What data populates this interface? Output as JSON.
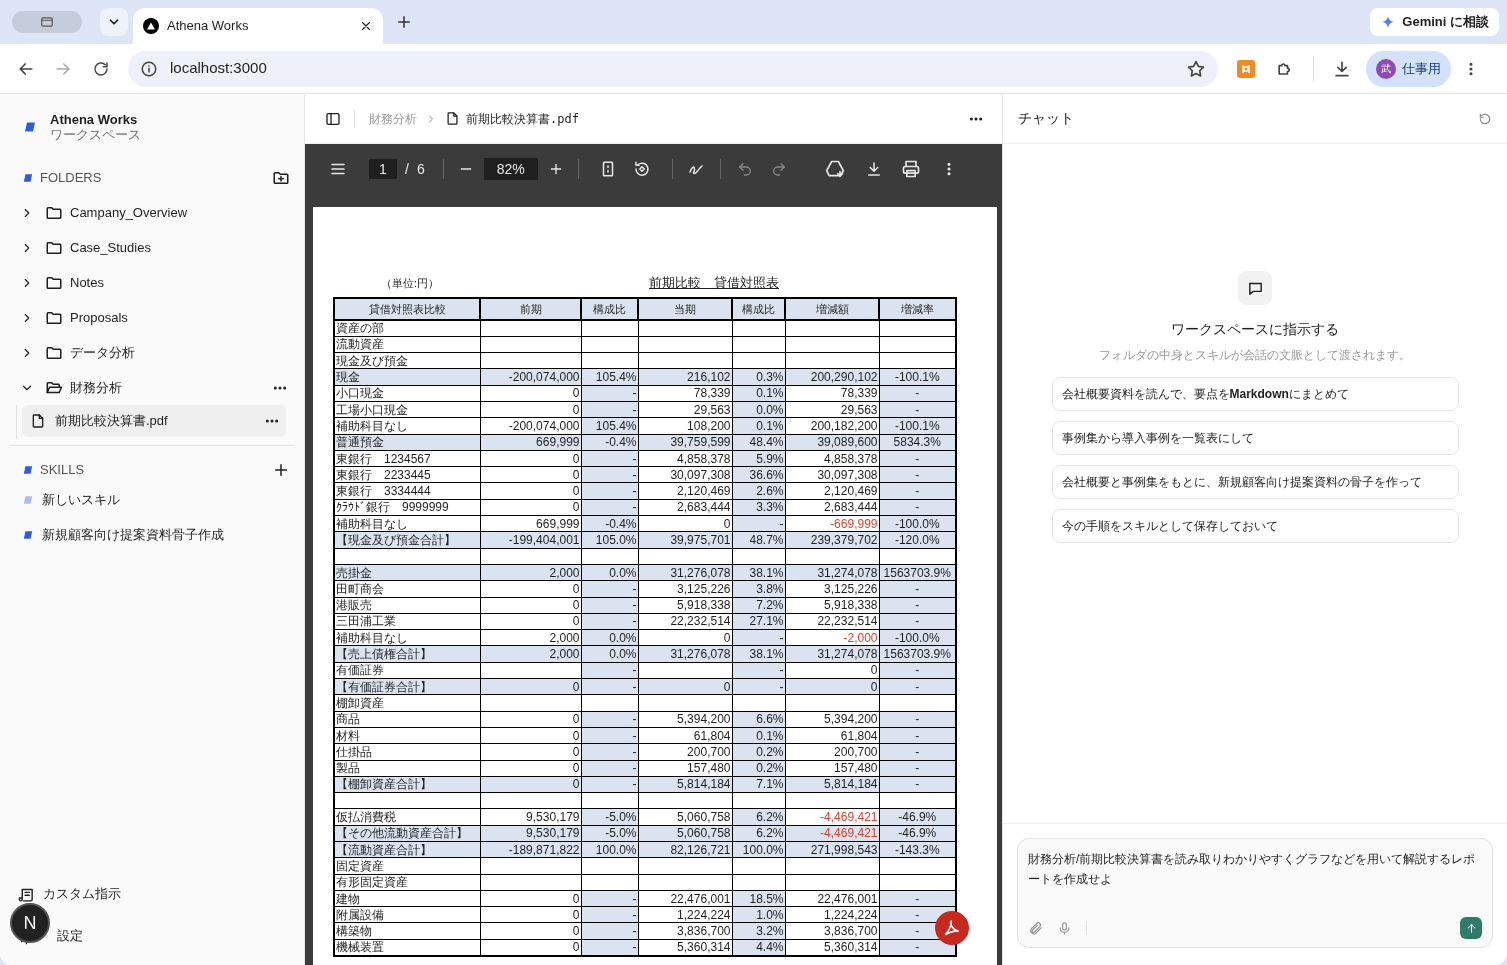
{
  "browser": {
    "tab_title": "Athena Works",
    "url": "localhost:3000",
    "gemini_button": "Gemini に相談",
    "profile_avatar": "武",
    "profile_name": "仕事用"
  },
  "sidebar": {
    "workspace_name": "Athena Works",
    "workspace_subtitle": "ワークスペース",
    "folders_heading": "FOLDERS",
    "folders": [
      {
        "label": "Campany_Overview",
        "expanded": false,
        "selected": false
      },
      {
        "label": "Case_Studies",
        "expanded": false,
        "selected": false
      },
      {
        "label": "Notes",
        "expanded": false,
        "selected": false
      },
      {
        "label": "Proposals",
        "expanded": false,
        "selected": false
      },
      {
        "label": "データ分析",
        "expanded": false,
        "selected": false
      },
      {
        "label": "財務分析",
        "expanded": true,
        "selected": false,
        "children": [
          {
            "label": "前期比較決算書.pdf",
            "selected": true
          }
        ]
      }
    ],
    "skills_heading": "SKILLS",
    "skills": [
      {
        "label": "新しいスキル",
        "color": "#a9bcf5"
      },
      {
        "label": "新規顧客向け提案資料骨子作成",
        "color": "#2d5be3"
      }
    ],
    "custom_instructions": "カスタム指示",
    "settings": "設定",
    "floating_button": "N"
  },
  "document": {
    "breadcrumb": [
      "財務分析",
      "前期比較決算書.pdf"
    ],
    "pdf_toolbar": {
      "page": "1",
      "page_separator": "/",
      "page_count": "6",
      "zoom": "82%"
    },
    "unit_label": "（単位:円）",
    "title": "前期比較　貸借対照表",
    "table": {
      "columns": [
        "貸借対照表比較",
        "前期",
        "構成比",
        "当期",
        "構成比",
        "増減額",
        "増減率"
      ],
      "rows": [
        {
          "kind": "heading",
          "label": "資産の部"
        },
        {
          "kind": "heading",
          "label": "流動資産"
        },
        {
          "kind": "heading",
          "label": "現金及び預金"
        },
        {
          "kind": "total",
          "label": "現金",
          "cells": [
            "-200,074,000",
            "105.4%",
            "216,102",
            "0.3%",
            "200,290,102",
            "-100.1%"
          ],
          "alert": false
        },
        {
          "kind": "detail",
          "label": "小口現金",
          "cells": [
            "0",
            "-",
            "78,339",
            "0.1%",
            "78,339",
            "-"
          ],
          "alert": false
        },
        {
          "kind": "detail",
          "label": "工場小口現金",
          "cells": [
            "0",
            "-",
            "29,563",
            "0.0%",
            "29,563",
            "-"
          ],
          "alert": false
        },
        {
          "kind": "detail",
          "label": "補助科目なし",
          "cells": [
            "-200,074,000",
            "105.4%",
            "108,200",
            "0.1%",
            "200,182,200",
            "-100.1%"
          ],
          "alert": false
        },
        {
          "kind": "total",
          "label": "普通預金",
          "cells": [
            "669,999",
            "-0.4%",
            "39,759,599",
            "48.4%",
            "39,089,600",
            "5834.3%"
          ],
          "alert": false
        },
        {
          "kind": "detail",
          "label": "東銀行　1234567",
          "cells": [
            "0",
            "-",
            "4,858,378",
            "5.9%",
            "4,858,378",
            "-"
          ],
          "alert": false
        },
        {
          "kind": "detail",
          "label": "東銀行　2233445",
          "cells": [
            "0",
            "-",
            "30,097,308",
            "36.6%",
            "30,097,308",
            "-"
          ],
          "alert": false
        },
        {
          "kind": "detail",
          "label": "東銀行　3334444",
          "cells": [
            "0",
            "-",
            "2,120,469",
            "2.6%",
            "2,120,469",
            "-"
          ],
          "alert": false
        },
        {
          "kind": "detail",
          "label": "ｸﾗｳﾄﾞ銀行　9999999",
          "cells": [
            "0",
            "-",
            "2,683,444",
            "3.3%",
            "2,683,444",
            "-"
          ],
          "alert": false
        },
        {
          "kind": "detail",
          "label": "補助科目なし",
          "cells": [
            "669,999",
            "-0.4%",
            "0",
            "-",
            "-669,999",
            "-100.0%"
          ],
          "alert": true
        },
        {
          "kind": "total",
          "label": "【現金及び預金合計】",
          "cells": [
            "-199,404,001",
            "105.0%",
            "39,975,701",
            "48.7%",
            "239,379,702",
            "-120.0%"
          ],
          "alert": false
        },
        {
          "kind": "blank"
        },
        {
          "kind": "total",
          "label": "売掛金",
          "cells": [
            "2,000",
            "0.0%",
            "31,276,078",
            "38.1%",
            "31,274,078",
            "1563703.9%"
          ],
          "alert": false
        },
        {
          "kind": "detail",
          "label": "田町商会",
          "cells": [
            "0",
            "-",
            "3,125,226",
            "3.8%",
            "3,125,226",
            "-"
          ],
          "alert": false
        },
        {
          "kind": "detail",
          "label": "港販売",
          "cells": [
            "0",
            "-",
            "5,918,338",
            "7.2%",
            "5,918,338",
            "-"
          ],
          "alert": false
        },
        {
          "kind": "detail",
          "label": "三田浦工業",
          "cells": [
            "0",
            "-",
            "22,232,514",
            "27.1%",
            "22,232,514",
            "-"
          ],
          "alert": false
        },
        {
          "kind": "detail",
          "label": "補助科目なし",
          "cells": [
            "2,000",
            "0.0%",
            "0",
            "-",
            "-2,000",
            "-100.0%"
          ],
          "alert": true
        },
        {
          "kind": "total",
          "label": "【売上債権合計】",
          "cells": [
            "2,000",
            "0.0%",
            "31,276,078",
            "38.1%",
            "31,274,078",
            "1563703.9%"
          ],
          "alert": false
        },
        {
          "kind": "detail",
          "label": "有価証券",
          "cells": [
            null,
            "-",
            null,
            "-",
            "0",
            "-"
          ],
          "alert": false
        },
        {
          "kind": "total",
          "label": "【有価証券合計】",
          "cells": [
            "0",
            "-",
            "0",
            "-",
            "0",
            "-"
          ],
          "alert": false
        },
        {
          "kind": "heading",
          "label": "棚卸資産"
        },
        {
          "kind": "detail",
          "label": "商品",
          "cells": [
            "0",
            "-",
            "5,394,200",
            "6.6%",
            "5,394,200",
            "-"
          ],
          "alert": false
        },
        {
          "kind": "detail",
          "label": "材料",
          "cells": [
            "0",
            "-",
            "61,804",
            "0.1%",
            "61,804",
            "-"
          ],
          "alert": false
        },
        {
          "kind": "detail",
          "label": "仕掛品",
          "cells": [
            "0",
            "-",
            "200,700",
            "0.2%",
            "200,700",
            "-"
          ],
          "alert": false
        },
        {
          "kind": "detail",
          "label": "製品",
          "cells": [
            "0",
            "-",
            "157,480",
            "0.2%",
            "157,480",
            "-"
          ],
          "alert": false
        },
        {
          "kind": "total",
          "label": "【棚卸資産合計】",
          "cells": [
            "0",
            "-",
            "5,814,184",
            "7.1%",
            "5,814,184",
            "-"
          ],
          "alert": false
        },
        {
          "kind": "blank"
        },
        {
          "kind": "detail",
          "label": "仮払消費税",
          "cells": [
            "9,530,179",
            "-5.0%",
            "5,060,758",
            "6.2%",
            "-4,469,421",
            "-46.9%"
          ],
          "alert": true
        },
        {
          "kind": "total",
          "label": "【その他流動資産合計】",
          "cells": [
            "9,530,179",
            "-5.0%",
            "5,060,758",
            "6.2%",
            "-4,469,421",
            "-46.9%"
          ],
          "alert": true
        },
        {
          "kind": "total",
          "label": "【流動資産合計】",
          "cells": [
            "-189,871,822",
            "100.0%",
            "82,126,721",
            "100.0%",
            "271,998,543",
            "-143.3%"
          ],
          "alert": false
        },
        {
          "kind": "heading",
          "label": "固定資産"
        },
        {
          "kind": "heading",
          "label": "有形固定資産"
        },
        {
          "kind": "detail",
          "label": "建物",
          "cells": [
            "0",
            "-",
            "22,476,001",
            "18.5%",
            "22,476,001",
            "-"
          ],
          "alert": false
        },
        {
          "kind": "detail",
          "label": "附属設備",
          "cells": [
            "0",
            "-",
            "1,224,224",
            "1.0%",
            "1,224,224",
            "-"
          ],
          "alert": false
        },
        {
          "kind": "detail",
          "label": "構築物",
          "cells": [
            "0",
            "-",
            "3,836,700",
            "3.2%",
            "3,836,700",
            "-"
          ],
          "alert": false
        },
        {
          "kind": "detail",
          "label": "機械装置",
          "cells": [
            "0",
            "-",
            "5,360,314",
            "4.4%",
            "5,360,314",
            "-"
          ],
          "alert": false
        }
      ]
    }
  },
  "chat": {
    "title": "チャット",
    "empty_title": "ワークスペースに指示する",
    "empty_subtitle": "フォルダの中身とスキルが会話の文脈として渡されます。",
    "suggestions": [
      "会社概要資料を読んで、要点を**Markdown**にまとめて",
      "事例集から導入事例を一覧表にして",
      "会社概要と事例集をもとに、新規顧客向け提案資料の骨子を作って",
      "今の手順をスキルとして保存しておいて"
    ],
    "input": {
      "value": "財務分析/前期比較決算書を読み取りわかりやすくグラフなどを用いて解説するレポートを作成せよ"
    }
  }
}
